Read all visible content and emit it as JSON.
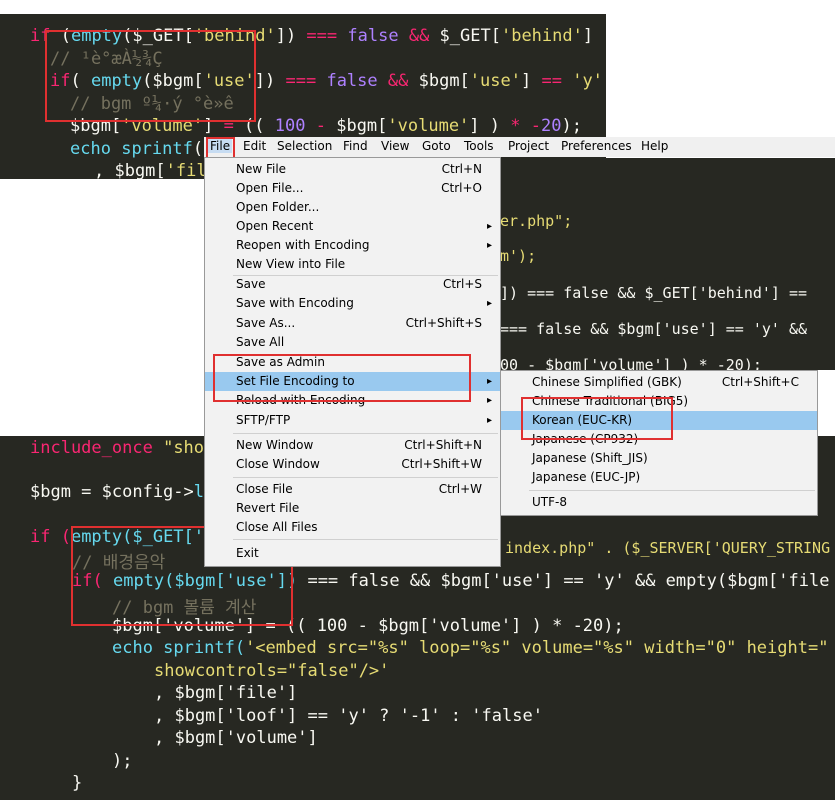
{
  "top_code": [
    "if (empty($_GET['behind']) === false && $_GET['behind']",
    "  // ¹è°æÀ½¾Ç",
    "  if( empty($bgm['use']) === false && $bgm['use'] == 'y'",
    "    // bgm º¼·ý °è»ê",
    "    $bgm['volume'] = (( 100 - $bgm['volume'] ) * -20);",
    "    echo sprintf(",
    "      , $bgm['fil"
  ],
  "middle_code": {
    "line1": "er.php\";",
    "line2": "m');",
    "line3": "]) === false && $_GET['behind'] ==",
    "line4": "=== false && $bgm['use'] == 'y' &&",
    "line5": "00 - $bgm['volume'] ) * -20);"
  },
  "bottom_code": {
    "l1a": "include_once",
    "l1b": "\"sho",
    "l2a": "$bgm = $config->",
    "l2b": "l",
    "l3a": "if (",
    "l3b": "empty($_GET['",
    "l3c": "index.php\" . ($_SERVER['QUERY_STRING",
    "l4": "// 배경음악",
    "l5a": "if(",
    "l5b": "empty($bgm['use'])",
    "l5c": "=== false && $bgm['use'] == 'y' && empty($bgm['file",
    "l6": "// bgm 볼륨 계산",
    "l7": "$bgm['volume'] = (( 100 - $bgm['volume'] ) * -20);",
    "l8a": "echo sprintf(",
    "l8b": "'<embed src=\"%s\" loop=\"%s\" volume=\"%s\" width=\"0\" height=\"",
    "l9": "showcontrols=\"false\"/>'",
    "l10": ", $bgm['file']",
    "l11": ", $bgm['loof'] == 'y' ? '-1' : 'false'",
    "l12": ", $bgm['volume']",
    "l13": ");",
    "l14": "}"
  },
  "menubar": [
    "File",
    "Edit",
    "Selection",
    "Find",
    "View",
    "Goto",
    "Tools",
    "Project",
    "Preferences",
    "Help"
  ],
  "file_menu": [
    {
      "label": "New File",
      "shortcut": "Ctrl+N",
      "submenu": false
    },
    {
      "label": "Open File...",
      "shortcut": "Ctrl+O",
      "submenu": false
    },
    {
      "label": "Open Folder...",
      "shortcut": "",
      "submenu": false
    },
    {
      "label": "Open Recent",
      "shortcut": "",
      "submenu": true
    },
    {
      "label": "Reopen with Encoding",
      "shortcut": "",
      "submenu": true
    },
    {
      "label": "New View into File",
      "shortcut": "",
      "submenu": false
    },
    {
      "label": "Save",
      "shortcut": "Ctrl+S",
      "submenu": false
    },
    {
      "label": "Save with Encoding",
      "shortcut": "",
      "submenu": true
    },
    {
      "label": "Save As...",
      "shortcut": "Ctrl+Shift+S",
      "submenu": false
    },
    {
      "label": "Save All",
      "shortcut": "",
      "submenu": false
    },
    {
      "label": "Save as Admin",
      "shortcut": "",
      "submenu": false
    },
    {
      "label": "Set File Encoding to",
      "shortcut": "",
      "submenu": true,
      "selected": true
    },
    {
      "label": "Reload with Encoding",
      "shortcut": "",
      "submenu": true
    },
    {
      "label": "SFTP/FTP",
      "shortcut": "",
      "submenu": true
    },
    {
      "label": "New Window",
      "shortcut": "Ctrl+Shift+N",
      "submenu": false
    },
    {
      "label": "Close Window",
      "shortcut": "Ctrl+Shift+W",
      "submenu": false
    },
    {
      "label": "Close File",
      "shortcut": "Ctrl+W",
      "submenu": false
    },
    {
      "label": "Revert File",
      "shortcut": "",
      "submenu": false
    },
    {
      "label": "Close All Files",
      "shortcut": "",
      "submenu": false
    },
    {
      "label": "Exit",
      "shortcut": "",
      "submenu": false
    }
  ],
  "encoding_menu": [
    {
      "label": "Chinese Simplified (GBK)",
      "shortcut": "Ctrl+Shift+C"
    },
    {
      "label": "Chinese Traditional (BIG5)",
      "shortcut": ""
    },
    {
      "label": "Korean (EUC-KR)",
      "shortcut": "",
      "selected": true
    },
    {
      "label": "Japanese (CP932)",
      "shortcut": ""
    },
    {
      "label": "Japanese (Shift_JIS)",
      "shortcut": ""
    },
    {
      "label": "Japanese (EUC-JP)",
      "shortcut": ""
    },
    {
      "label": "UTF-8",
      "shortcut": ""
    }
  ],
  "colors": {
    "editor_bg": "#272822",
    "menu_bg": "#f2f2f2",
    "selection": "#99c9ef",
    "highlight_box": "#e03030"
  }
}
